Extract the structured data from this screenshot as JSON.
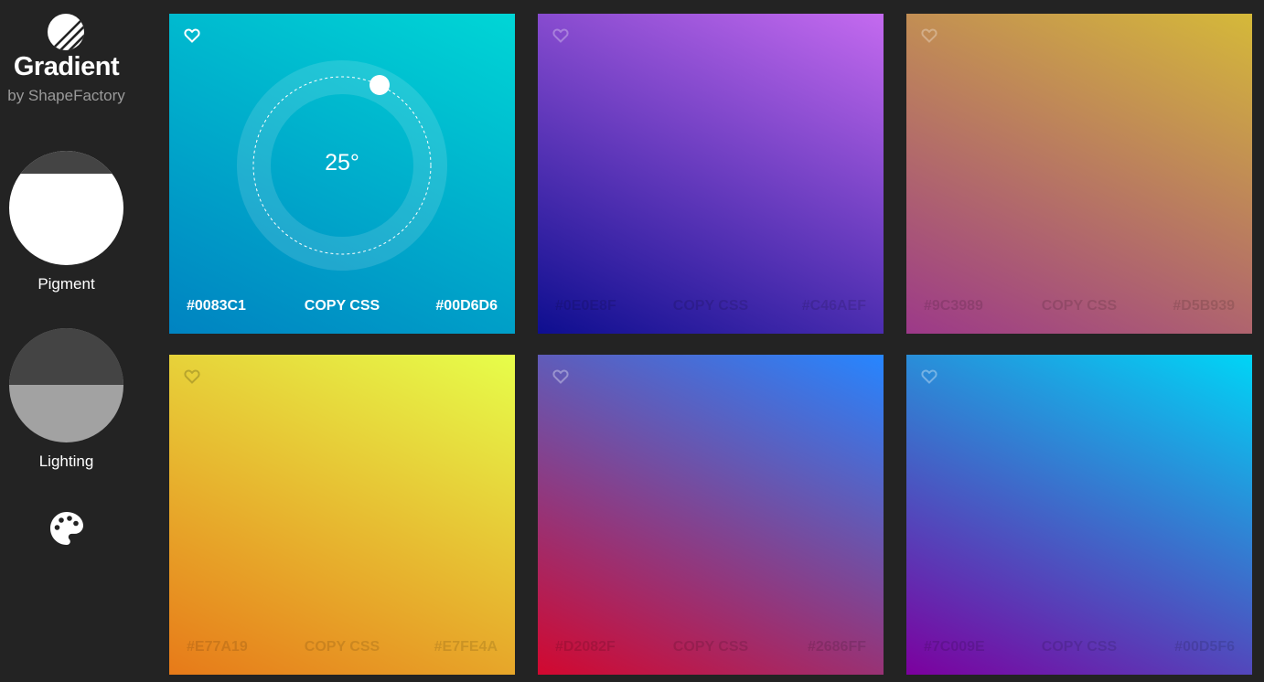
{
  "app": {
    "title": "Gradient",
    "byline": "by ShapeFactory",
    "logo_icon": "striped-circle-logo-icon"
  },
  "sidebar": {
    "pigment_label": "Pigment",
    "lighting_label": "Lighting",
    "pigment_icon": "half-filled-circle-knob",
    "lighting_icon": "half-filled-circle-knob",
    "palette_icon": "palette-icon"
  },
  "cards": [
    {
      "from": "#0083C1",
      "to": "#00D6D6",
      "copy": "COPY CSS",
      "heart_icon": "heart-outline-icon",
      "active": true,
      "angle_label": "25°"
    },
    {
      "from": "#0E0E8F",
      "to": "#C46AEF",
      "copy": "COPY CSS",
      "heart_icon": "heart-outline-icon",
      "active": false
    },
    {
      "from": "#9C3989",
      "to": "#D5B939",
      "copy": "COPY CSS",
      "heart_icon": "heart-outline-icon",
      "active": false
    },
    {
      "from": "#E77A19",
      "to": "#E7FE4A",
      "copy": "COPY CSS",
      "heart_icon": "heart-outline-icon",
      "active": false
    },
    {
      "from": "#D2082F",
      "to": "#2686FF",
      "copy": "COPY CSS",
      "heart_icon": "heart-outline-icon",
      "active": false
    },
    {
      "from": "#7C009E",
      "to": "#00D5F6",
      "copy": "COPY CSS",
      "heart_icon": "heart-outline-icon",
      "active": false
    }
  ]
}
